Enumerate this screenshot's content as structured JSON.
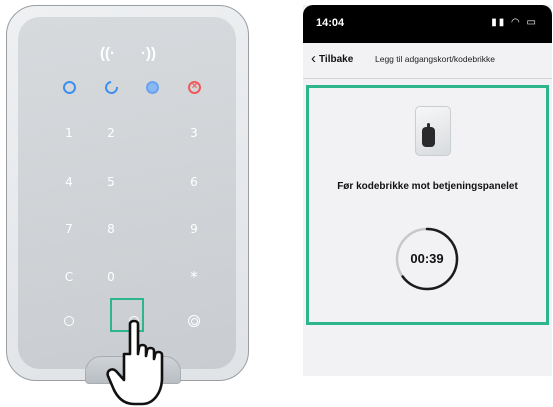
{
  "keypad": {
    "keys": [
      "1",
      "2",
      "3",
      "4",
      "5",
      "6",
      "7",
      "8",
      "9",
      "C",
      "0",
      "*"
    ],
    "nfc_icons": [
      "nfc-left-icon",
      "nfc-right-icon"
    ],
    "status_icons": [
      "armed-icon",
      "disarmed-icon",
      "night-mode-icon",
      "alarm-icon"
    ]
  },
  "phone": {
    "status": {
      "time": "14:04",
      "icons": [
        "signal-icon",
        "wifi-icon",
        "battery-icon"
      ]
    },
    "nav": {
      "back_label": "Tilbake",
      "title": "Legg til adgangskort/kodebrikke"
    },
    "instruction": "Før kodebrikke mot betjeningspanelet",
    "timer": {
      "text": "00:39",
      "progress": 0.65
    }
  },
  "colors": {
    "highlight": "#2db68c",
    "blue": "#3b8ff0",
    "red": "#ee5b5b"
  }
}
